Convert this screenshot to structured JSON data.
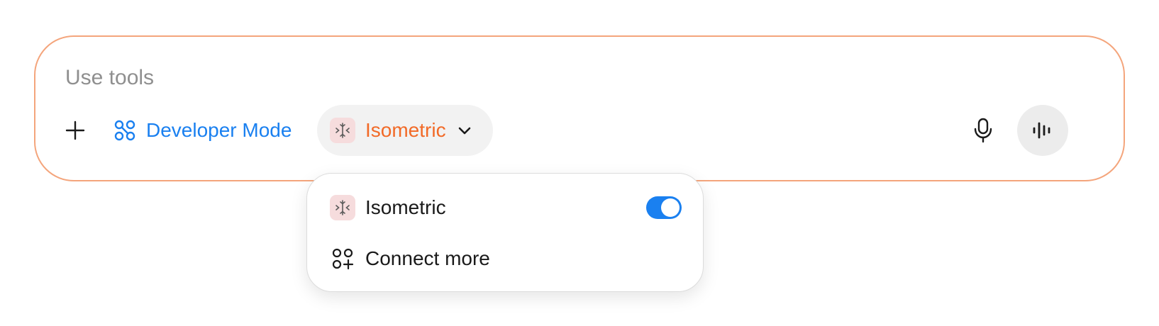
{
  "colors": {
    "accent": "#1a80f0",
    "brand": "#f26a27",
    "border": "#f4a57c"
  },
  "composer": {
    "placeholder": "Use tools",
    "add_icon": "plus-icon",
    "developer_mode": {
      "label": "Developer Mode",
      "icon": "developer-mode-icon"
    },
    "tool_chip": {
      "label": "Isometric",
      "icon": "isometric-app-icon",
      "chevron": "chevron-down-icon"
    },
    "mic_icon": "microphone-icon",
    "voice_icon": "voice-waveform-icon"
  },
  "dropdown": {
    "items": [
      {
        "label": "Isometric",
        "icon": "isometric-app-icon",
        "enabled": true
      },
      {
        "label": "Connect more",
        "icon": "connect-more-icon"
      }
    ]
  }
}
